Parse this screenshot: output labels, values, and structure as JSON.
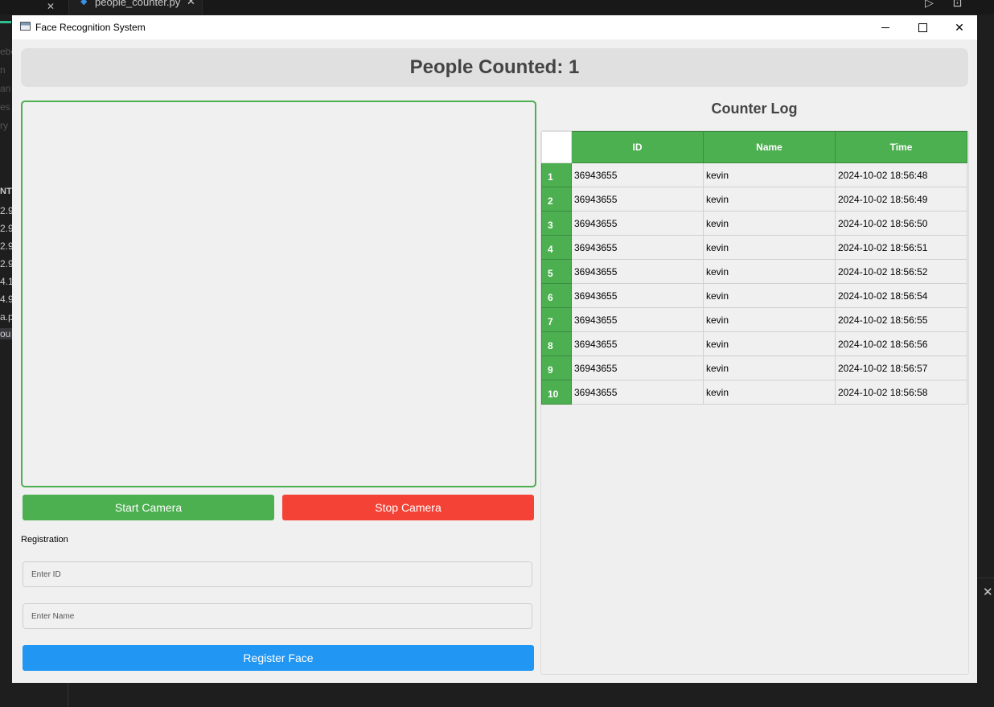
{
  "editor": {
    "tab_file": "people_counter.py",
    "left_lines": [
      "ebo",
      "n",
      "an",
      "es",
      "ry",
      "NT",
      "2.9",
      "2.9",
      "2.9",
      "2.9",
      "4.1",
      "4.9",
      "a.p",
      "ou"
    ]
  },
  "window": {
    "title": "Face Recognition System"
  },
  "header": {
    "people_counted": "People Counted: 1"
  },
  "controls": {
    "start_label": "Start Camera",
    "stop_label": "Stop Camera"
  },
  "registration": {
    "label": "Registration",
    "id_placeholder": "Enter ID",
    "name_placeholder": "Enter Name",
    "register_label": "Register Face"
  },
  "log": {
    "title": "Counter Log",
    "columns": [
      "ID",
      "Name",
      "Time"
    ],
    "rows": [
      {
        "num": "1",
        "id": "36943655",
        "name": "kevin",
        "time": "2024-10-02 18:56:48"
      },
      {
        "num": "2",
        "id": "36943655",
        "name": "kevin",
        "time": "2024-10-02 18:56:49"
      },
      {
        "num": "3",
        "id": "36943655",
        "name": "kevin",
        "time": "2024-10-02 18:56:50"
      },
      {
        "num": "4",
        "id": "36943655",
        "name": "kevin",
        "time": "2024-10-02 18:56:51"
      },
      {
        "num": "5",
        "id": "36943655",
        "name": "kevin",
        "time": "2024-10-02 18:56:52"
      },
      {
        "num": "6",
        "id": "36943655",
        "name": "kevin",
        "time": "2024-10-02 18:56:54"
      },
      {
        "num": "7",
        "id": "36943655",
        "name": "kevin",
        "time": "2024-10-02 18:56:55"
      },
      {
        "num": "8",
        "id": "36943655",
        "name": "kevin",
        "time": "2024-10-02 18:56:56"
      },
      {
        "num": "9",
        "id": "36943655",
        "name": "kevin",
        "time": "2024-10-02 18:56:57"
      },
      {
        "num": "10",
        "id": "36943655",
        "name": "kevin",
        "time": "2024-10-02 18:56:58"
      }
    ]
  },
  "colors": {
    "green": "#4caf50",
    "red": "#f44336",
    "blue": "#2196f3"
  }
}
